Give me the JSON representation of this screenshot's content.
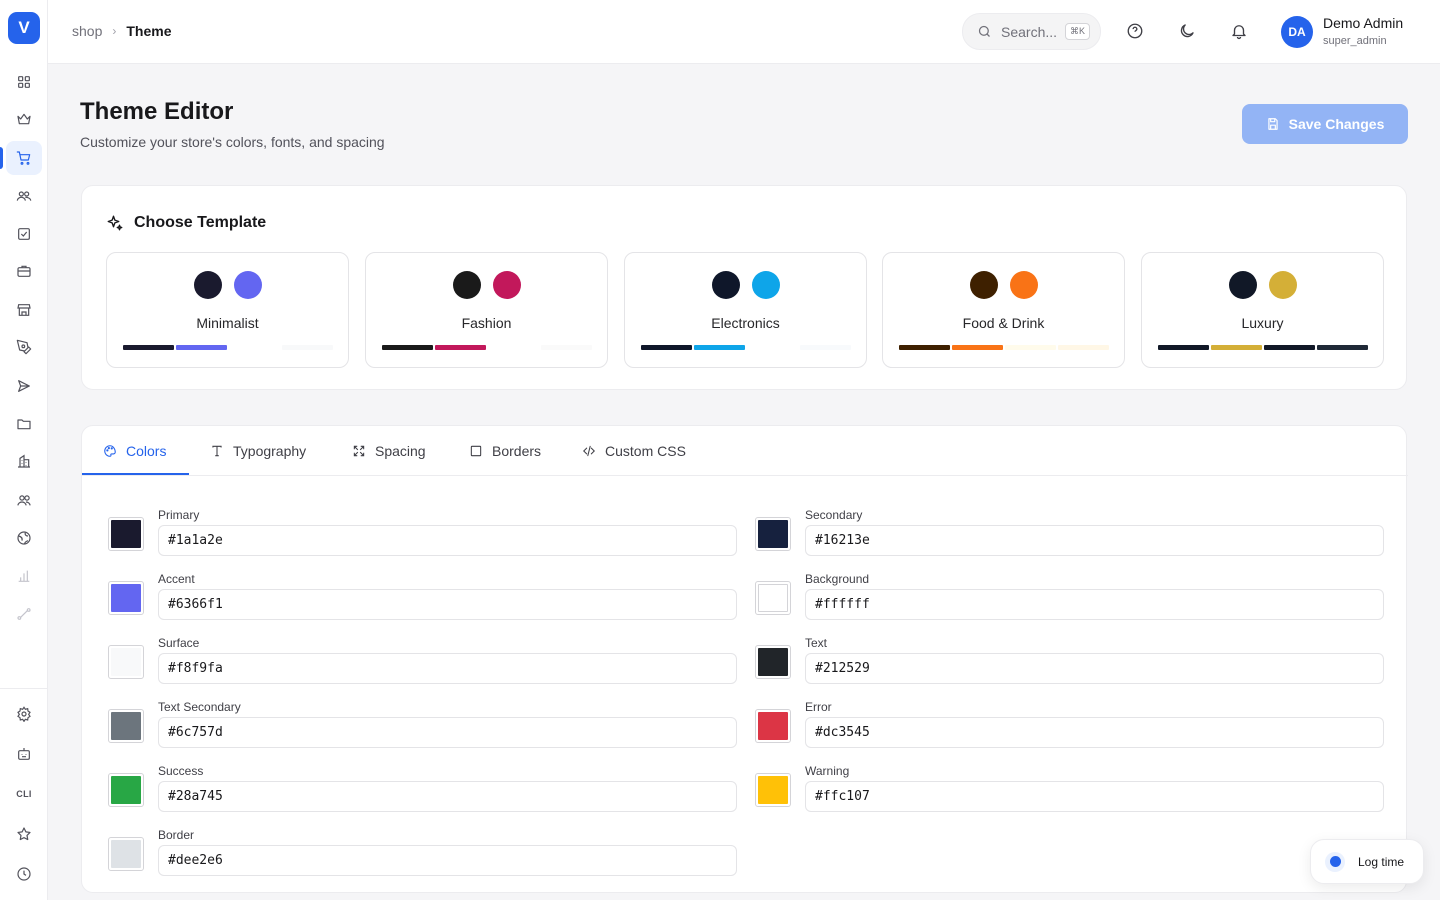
{
  "app": {
    "logo_letter": "V",
    "accent": "#2563eb"
  },
  "sidebar": {
    "items": [
      {
        "icon": "dashboard-grid-icon"
      },
      {
        "icon": "crown-icon"
      },
      {
        "icon": "shopping-cart-icon",
        "active": true
      },
      {
        "icon": "users-group-icon"
      },
      {
        "icon": "checkbox-icon"
      },
      {
        "icon": "briefcase-icon"
      },
      {
        "icon": "store-icon"
      },
      {
        "icon": "pen-tool-icon"
      },
      {
        "icon": "send-icon"
      },
      {
        "icon": "folder-icon"
      },
      {
        "icon": "building-icon"
      },
      {
        "icon": "user-pair-icon"
      },
      {
        "icon": "globe-icon"
      },
      {
        "icon": "bar-chart-icon"
      },
      {
        "icon": "route-icon"
      }
    ],
    "bottom_items": [
      {
        "icon": "settings-gear-icon"
      },
      {
        "icon": "bot-icon"
      },
      {
        "label": "CLI"
      },
      {
        "icon": "star-icon"
      },
      {
        "icon": "clock-icon"
      }
    ]
  },
  "header": {
    "breadcrumb": {
      "parent": "shop",
      "current": "Theme"
    },
    "search": {
      "placeholder": "Search...",
      "shortcut": "⌘K"
    },
    "user": {
      "initials": "DA",
      "name": "Demo Admin",
      "role": "super_admin"
    }
  },
  "page": {
    "title": "Theme Editor",
    "subtitle": "Customize your store's colors, fonts, and spacing",
    "save_label": "Save Changes"
  },
  "templates": {
    "title": "Choose Template",
    "items": [
      {
        "name": "Minimalist",
        "dots": [
          "#1a1a2e",
          "#6366f1"
        ],
        "bars": [
          "#1a1a2e",
          "#6366f1",
          "#ffffff",
          "#f8f9fa"
        ]
      },
      {
        "name": "Fashion",
        "dots": [
          "#1a1a1a",
          "#c2185b"
        ],
        "bars": [
          "#1a1a1a",
          "#c2185b",
          "#ffffff",
          "#fafafa"
        ]
      },
      {
        "name": "Electronics",
        "dots": [
          "#0f172a",
          "#0ea5e9"
        ],
        "bars": [
          "#0f172a",
          "#0ea5e9",
          "#ffffff",
          "#f8fafc"
        ]
      },
      {
        "name": "Food & Drink",
        "dots": [
          "#3e2000",
          "#f97316"
        ],
        "bars": [
          "#3e2000",
          "#f97316",
          "#fffbeb",
          "#fff7e6"
        ]
      },
      {
        "name": "Luxury",
        "dots": [
          "#111827",
          "#d4af37"
        ],
        "bars": [
          "#111827",
          "#d4af37",
          "#111827",
          "#1f2937"
        ]
      }
    ]
  },
  "tabs": [
    {
      "label": "Colors",
      "icon": "palette-icon",
      "active": true
    },
    {
      "label": "Typography",
      "icon": "type-icon"
    },
    {
      "label": "Spacing",
      "icon": "expand-icon"
    },
    {
      "label": "Borders",
      "icon": "square-icon"
    },
    {
      "label": "Custom CSS",
      "icon": "code-icon"
    }
  ],
  "colors": [
    {
      "label": "Primary",
      "value": "#1a1a2e"
    },
    {
      "label": "Secondary",
      "value": "#16213e"
    },
    {
      "label": "Accent",
      "value": "#6366f1"
    },
    {
      "label": "Background",
      "value": "#ffffff"
    },
    {
      "label": "Surface",
      "value": "#f8f9fa"
    },
    {
      "label": "Text",
      "value": "#212529"
    },
    {
      "label": "Text Secondary",
      "value": "#6c757d"
    },
    {
      "label": "Error",
      "value": "#dc3545"
    },
    {
      "label": "Success",
      "value": "#28a745"
    },
    {
      "label": "Warning",
      "value": "#ffc107"
    },
    {
      "label": "Border",
      "value": "#dee2e6"
    }
  ],
  "log_time": {
    "label": "Log time"
  }
}
